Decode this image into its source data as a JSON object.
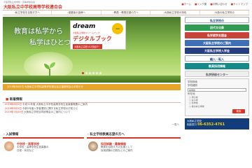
{
  "header": {
    "tagline": "大阪府私立中学校・高等学校協会",
    "logo": "大阪私立中学校高等学校連合会",
    "util": [
      "ホーム",
      "リンク集",
      "お問い合わせ",
      "サイトマップ"
    ]
  },
  "nav": [
    "私立学校を目指す方へ",
    "保護者の皆様へ",
    "教員・教員志望の方へ",
    "大阪私立学校の特色",
    "大阪の私立学校の"
  ],
  "hero": {
    "line1": "教育は私学から",
    "line2": "私学はひとつ",
    "promo": {
      "title": "dream",
      "sub": "大阪私立学校ドリームブック",
      "digital": "デジタルブック",
      "badge": "102",
      "caption": "大阪私立高校102校紹介！"
    },
    "slides_total": 6,
    "slide_active": 1
  },
  "notice": "2019年8月5日 大阪私立中学校高等学校連合会主催説明会のお知らせ",
  "news": {
    "heading": "新着情報",
    "items": [
      {
        "date": "2019年8月5日",
        "text": "平成31年度 大阪私立中学校高等学校生徒募集概要のご案内"
      },
      {
        "date": "2019年8月1日",
        "text": "令和2年度入学者選抜に関する私立学校のお知らせ"
      },
      {
        "date": "2019年7月29日",
        "text": "大阪私立学校合同説明会のご案内について"
      }
    ],
    "more": "一覧へ"
  },
  "sections": {
    "left": {
      "heading": "入試情報",
      "title": "中学校・高等学校",
      "lines": [
        "中学校・高等学校生徒募集の",
        "日程・状況など"
      ]
    },
    "right": {
      "heading": "私立学校教員志望の方へ",
      "title": "採用試験・募集情報",
      "lines": [
        "教員を目指す方の支援として",
        "採用試験の日程などのご案内"
      ]
    }
  },
  "sidebar": {
    "banners": [
      {
        "label": "私立学校の",
        "style": "bn-white"
      },
      {
        "label": "初代文化祭",
        "style": "bn-green"
      },
      {
        "label": "私学就学支援金",
        "style": "bn-red"
      },
      {
        "label": "大阪私立学校のご案内",
        "style": "bn-blue"
      },
      {
        "label": "大阪私立学校入学金",
        "style": "bn-navy"
      },
      {
        "label": "編入・転入",
        "style": "bn-white"
      },
      {
        "label": "教員採用情報",
        "style": "bn-teal"
      },
      {
        "label": "私学研修センター",
        "style": "bn-gray"
      }
    ],
    "search": {
      "heading": "学校検索",
      "label1": "学校種別",
      "field1": "中学校",
      "label2": "所在地",
      "options": [
        "男子校",
        "女子校",
        "共学校",
        "寮のある学校"
      ],
      "button": "検索"
    },
    "ad": {
      "line1": "大阪私立学校",
      "line2": "相談窓口",
      "phone": "06-6352-4761"
    }
  },
  "colors": {
    "accent": "#d3362a",
    "notice": "#e8a52a"
  }
}
